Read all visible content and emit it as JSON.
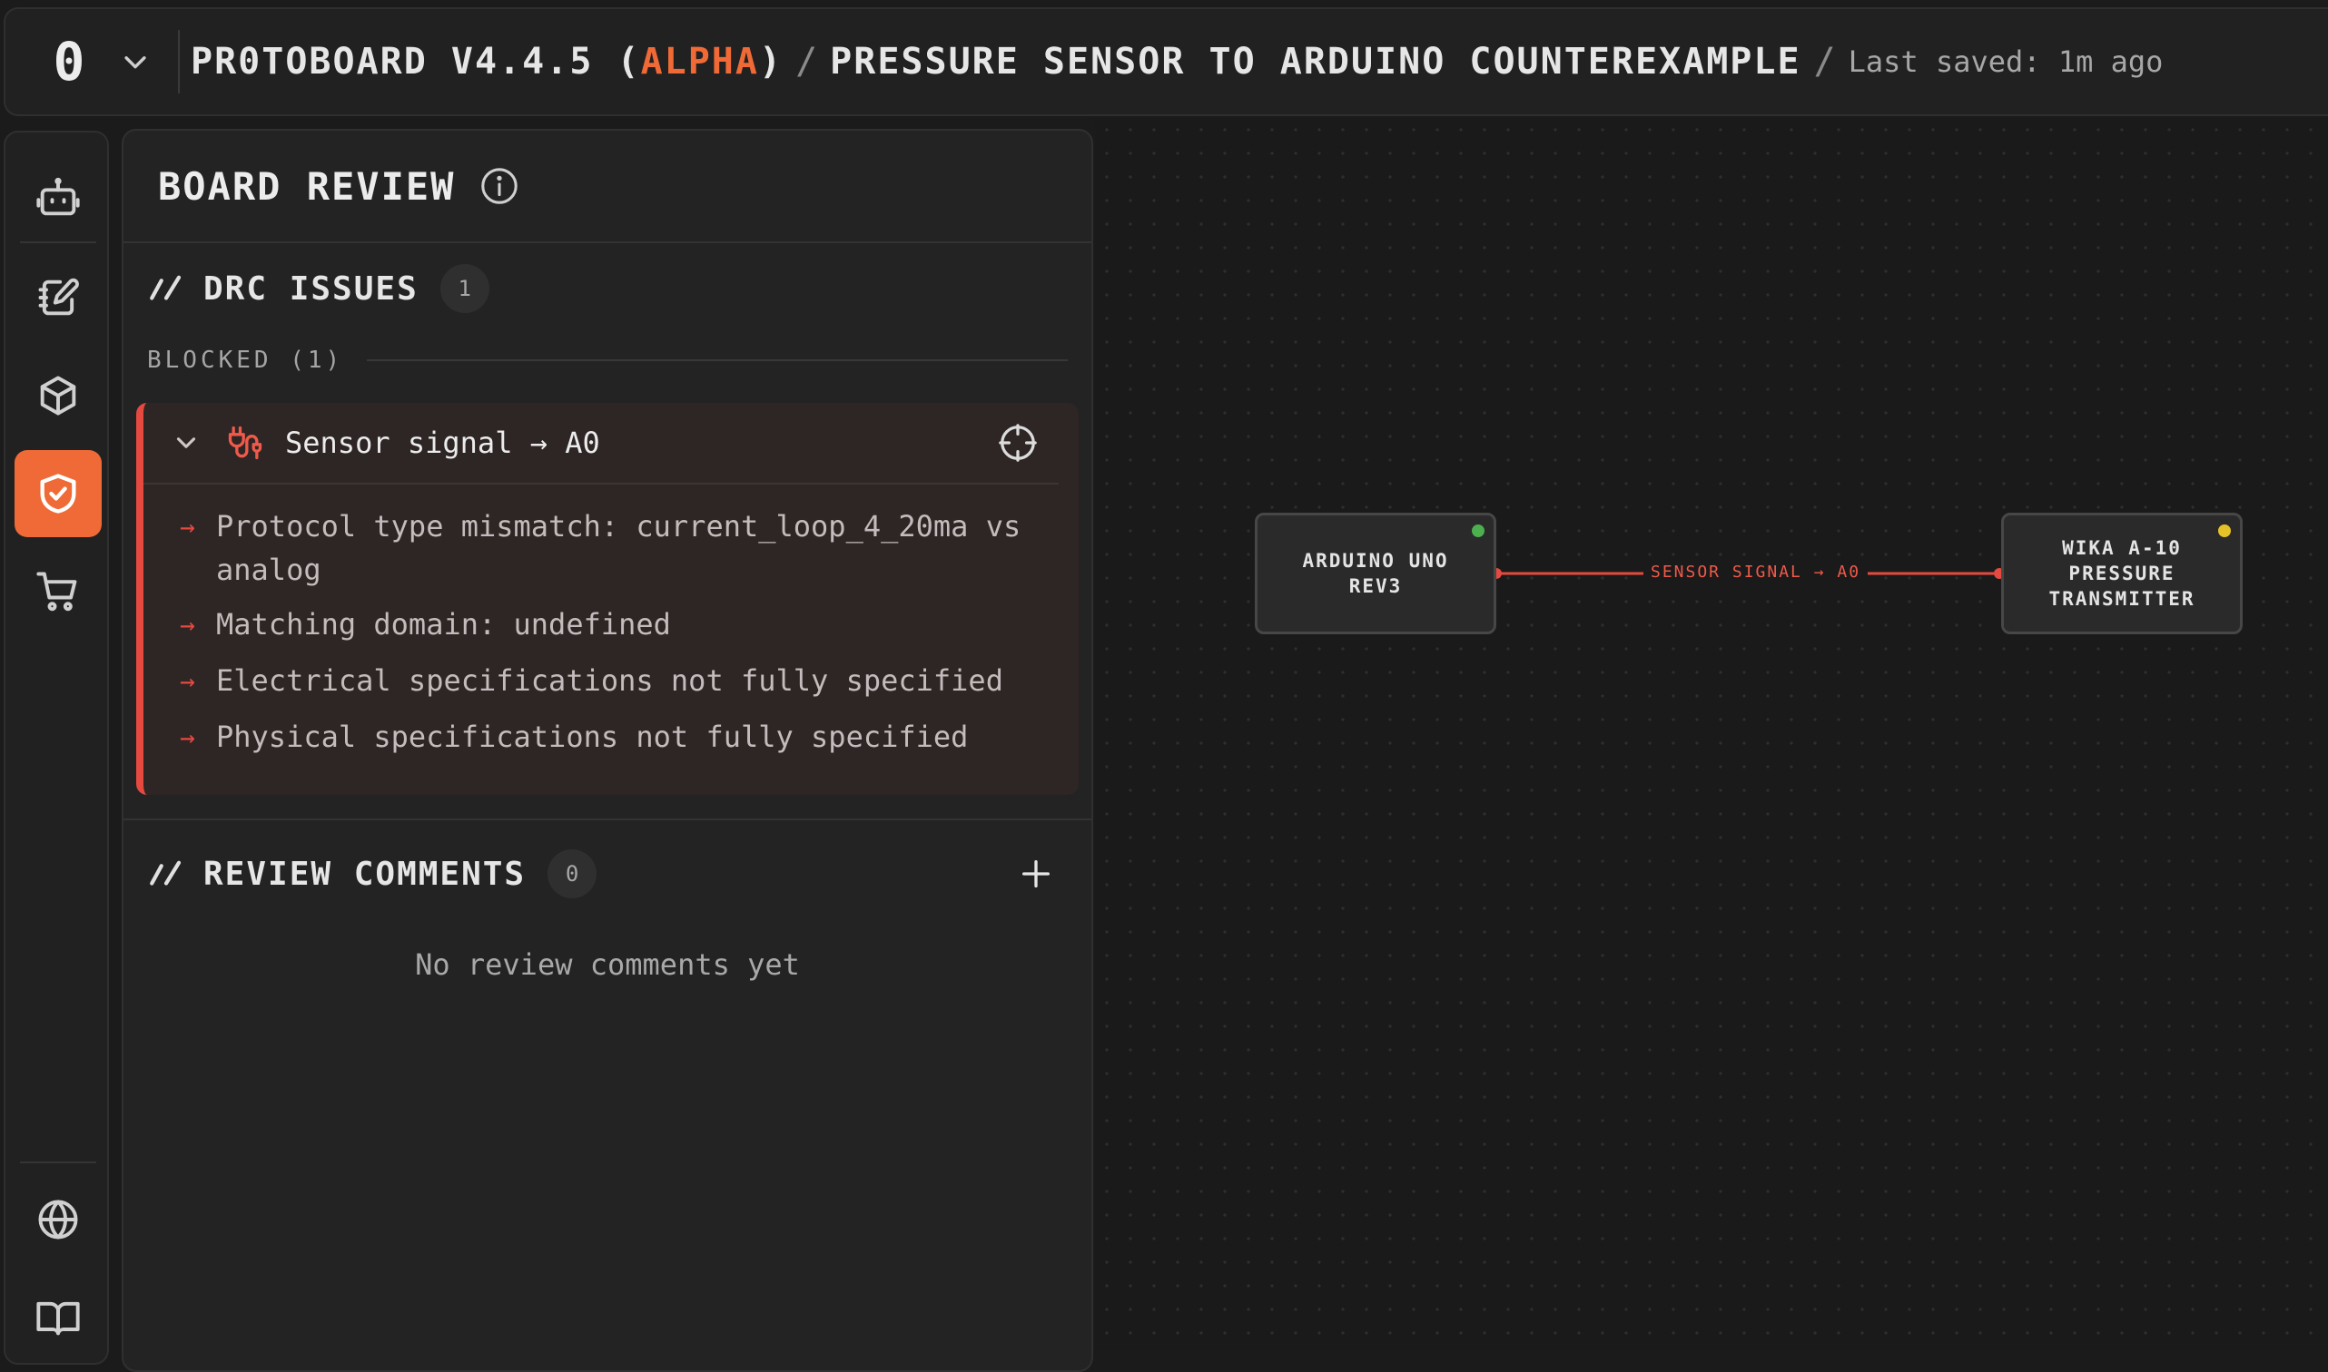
{
  "topbar": {
    "logo": "0",
    "app_name_prefix": "PR0TOBOARD V4.4.5 (",
    "app_tag": "ALPHA",
    "app_name_suffix": ")",
    "separator": "/",
    "project_name": "PRESSURE SENSOR TO ARDUINO COUNTEREXAMPLE",
    "saved_status": "Last saved: 1m ago"
  },
  "rail": {
    "items": [
      {
        "icon": "robot-icon",
        "active": false
      },
      {
        "icon": "notebook-edit-icon",
        "active": false
      },
      {
        "icon": "cube-icon",
        "active": false
      },
      {
        "icon": "shield-check-icon",
        "active": true
      },
      {
        "icon": "cart-icon",
        "active": false
      },
      {
        "icon": "globe-icon",
        "active": false
      },
      {
        "icon": "book-icon",
        "active": false
      }
    ]
  },
  "panel": {
    "title": "BOARD REVIEW",
    "drc": {
      "title": "DRC ISSUES",
      "count": "1",
      "group_label": "BLOCKED (1)",
      "issues": [
        {
          "title": "Sensor signal → A0",
          "details": [
            "Protocol type mismatch: current_loop_4_20ma vs analog",
            "Matching domain: undefined",
            "Electrical specifications not fully specified",
            "Physical specifications not fully specified"
          ]
        }
      ]
    },
    "comments": {
      "title": "REVIEW COMMENTS",
      "count": "0",
      "empty": "No review comments yet"
    }
  },
  "canvas": {
    "nodes": [
      {
        "label": "ARDUINO UNO REV3",
        "status_color": "#4caf50"
      },
      {
        "label": "WIKA A-10 PRESSURE TRANSMITTER",
        "status_color": "#e6c229"
      }
    ],
    "wire_label": "SENSOR SIGNAL → A0",
    "wire_color": "#e5493f"
  },
  "colors": {
    "accent": "#ef6a36",
    "error": "#e5493f"
  }
}
